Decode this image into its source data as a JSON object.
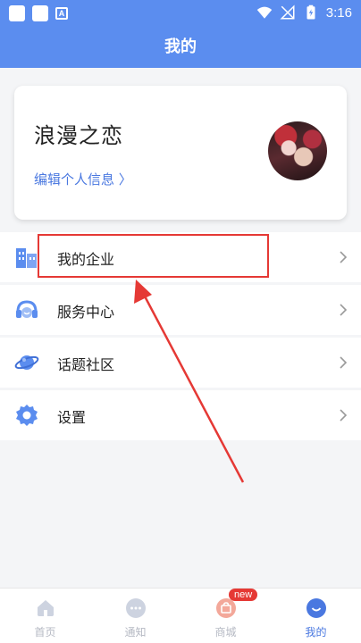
{
  "status_bar": {
    "time": "3:16",
    "a_icon": "A"
  },
  "header": {
    "title": "我的"
  },
  "profile": {
    "name": "浪漫之恋",
    "edit_link": "编辑个人信息 〉"
  },
  "menu": {
    "items": [
      {
        "label": "我的企业",
        "icon": "building-icon"
      },
      {
        "label": "服务中心",
        "icon": "headset-icon"
      },
      {
        "label": "话题社区",
        "icon": "planet-icon"
      },
      {
        "label": "设置",
        "icon": "gear-icon"
      }
    ]
  },
  "bottom_nav": {
    "items": [
      {
        "label": "首页",
        "icon": "home-icon"
      },
      {
        "label": "通知",
        "icon": "chat-bubble-icon"
      },
      {
        "label": "商城",
        "icon": "shopping-bag-icon",
        "badge": "new"
      },
      {
        "label": "我的",
        "icon": "smile-icon",
        "active": true
      }
    ]
  },
  "colors": {
    "primary": "#5b8def",
    "accent_text": "#4a78e0",
    "annotation_red": "#e53935",
    "nav_inactive": "#b5b9c3"
  }
}
